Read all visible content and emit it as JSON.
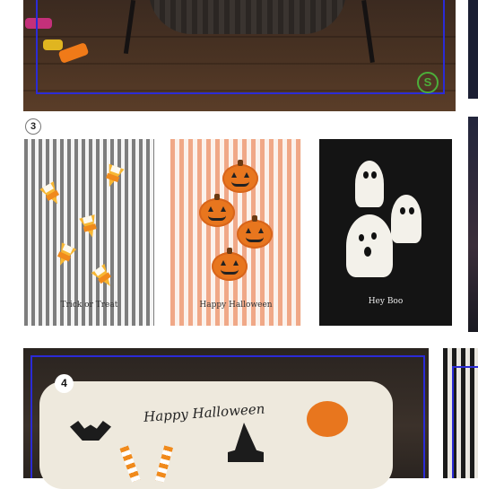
{
  "top_section": {
    "sale_badge": "S"
  },
  "section_3": {
    "number": "3",
    "towels": [
      {
        "label": "Trick or Treat",
        "motif": "candy-corn"
      },
      {
        "label": "Happy Halloween",
        "motif": "jack-o-lantern"
      },
      {
        "label": "Hey Boo",
        "motif": "ghost"
      }
    ]
  },
  "section_4": {
    "number": "4",
    "pillow_text": "Happy Halloween"
  },
  "colors": {
    "frame_blue": "#2b2bd6",
    "badge_green": "#4caf3a",
    "pumpkin_orange": "#e8761e",
    "candy_yellow": "#f7b733"
  }
}
